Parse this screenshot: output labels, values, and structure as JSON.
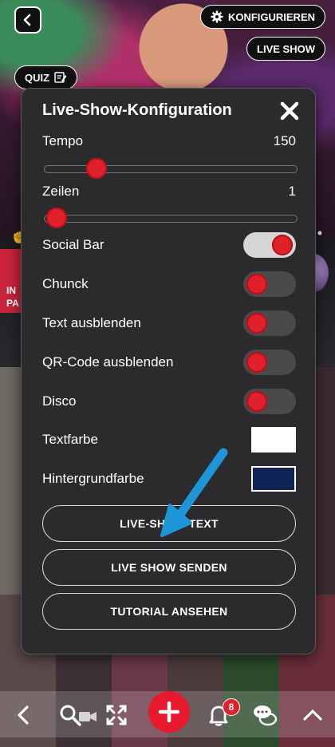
{
  "header": {
    "configure_label": "KONFIGURIEREN",
    "live_show_label": "LIVE SHOW",
    "quiz_label": "QUIZ"
  },
  "modal": {
    "title": "Live-Show-Konfiguration",
    "tempo": {
      "label": "Tempo",
      "value": "150",
      "fraction": 0.17
    },
    "zeilen": {
      "label": "Zeilen",
      "value": "1",
      "fraction": 0.0
    },
    "toggles": [
      {
        "label": "Social Bar",
        "on": true
      },
      {
        "label": "Chunck",
        "on": false
      },
      {
        "label": "Text ausblenden",
        "on": false
      },
      {
        "label": "QR-Code ausblenden",
        "on": false
      },
      {
        "label": "Disco",
        "on": false
      }
    ],
    "text_color": {
      "label": "Textfarbe",
      "color": "#ffffff"
    },
    "bg_color": {
      "label": "Hintergrundfarbe",
      "color": "#0f2557"
    },
    "buttons": [
      "LIVE-SHOW-TEXT",
      "LIVE SHOW SENDEN",
      "TUTORIAL ANSEHEN"
    ]
  },
  "background": {
    "card_text": "IN\nPA"
  },
  "bottom_bar": {
    "notification_count": "8"
  },
  "colors": {
    "accent_red": "#e0202a",
    "arrow_blue": "#1e95d8",
    "modal_bg": "#2b2b2d"
  }
}
